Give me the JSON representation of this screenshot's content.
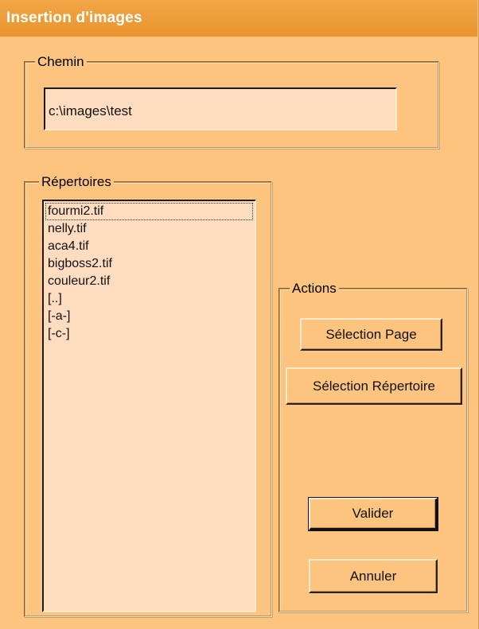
{
  "window": {
    "title": "Insertion d'images"
  },
  "path": {
    "legend": "Chemin",
    "value": "c:\\images\\test"
  },
  "directories": {
    "legend": "Répertoires",
    "items": [
      {
        "label": "fourmi2.tif"
      },
      {
        "label": "nelly.tif"
      },
      {
        "label": "aca4.tif"
      },
      {
        "label": "bigboss2.tif"
      },
      {
        "label": "couleur2.tif"
      },
      {
        "label": "[..]"
      },
      {
        "label": "[-a-]"
      },
      {
        "label": "[-c-]"
      }
    ]
  },
  "actions": {
    "legend": "Actions",
    "select_page": "Sélection Page",
    "select_directory": "Sélection Répertoire",
    "validate": "Valider",
    "cancel": "Annuler"
  },
  "colors": {
    "titlebar": "#EA962F",
    "window_bg": "#FCC47E",
    "field_bg": "#FDDCC0"
  }
}
